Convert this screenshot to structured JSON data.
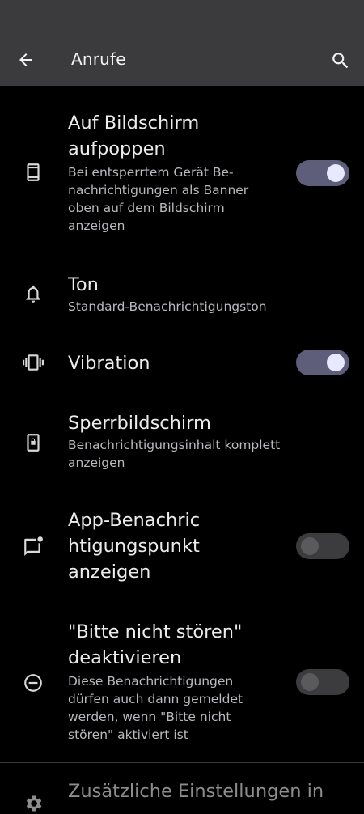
{
  "app_bar": {
    "title": "Anrufe"
  },
  "colors": {
    "app_bar_bg": "#3b3b3d",
    "background": "#000000",
    "switch_on_track": "#5e5e7a",
    "switch_on_thumb": "#e8e8ff",
    "switch_off_track": "#3c3c3e",
    "switch_off_thumb": "#5a5a5c"
  },
  "settings": [
    {
      "icon": "phone-screen-icon",
      "title_lines": [
        "Auf Bildschirm",
        "aufpoppen"
      ],
      "summary_lines": [
        "Bei entsperrtem Gerät Be-",
        "nachrichtigungen als Banner",
        "oben auf dem Bildschirm",
        "anzeigen"
      ],
      "switch": "on"
    },
    {
      "icon": "bell-icon",
      "title_lines": [
        "Ton"
      ],
      "summary_lines": [
        "Standard-Benachrichtigungston"
      ]
    },
    {
      "icon": "vibration-icon",
      "title_lines": [
        "Vibration"
      ],
      "switch": "on"
    },
    {
      "icon": "lock-screen-icon",
      "title_lines": [
        "Sperrbildschirm"
      ],
      "summary_lines": [
        "Benachrichtigungsinhalt komplett",
        "anzeigen"
      ]
    },
    {
      "icon": "notification-dot-icon",
      "title_lines": [
        "App-Benachric",
        "htigungspunkt",
        "anzeigen"
      ],
      "switch": "off"
    },
    {
      "icon": "do-not-disturb-icon",
      "title_lines": [
        "\"Bitte nicht stören\"",
        "deaktivieren"
      ],
      "summary_lines": [
        "Diese Benachrichtigungen",
        "dürfen auch dann gemeldet",
        "werden, wenn \"Bitte nicht",
        "stören\" aktiviert ist"
      ],
      "switch": "off"
    }
  ],
  "extra": {
    "icon": "gear-icon",
    "title": "Zusätzliche Einstellungen in"
  }
}
